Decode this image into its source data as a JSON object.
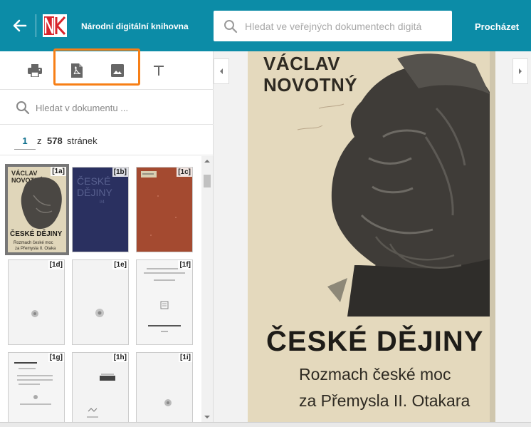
{
  "header": {
    "brand": "Národní digitální knihovna",
    "search_placeholder": "Hledat ve veřejných dokumentech digitá",
    "browse_label": "Procházet",
    "accent_color": "#0c8ca7"
  },
  "toolbar": {
    "icons": [
      "print-icon",
      "pdf-icon",
      "image-icon",
      "text-icon"
    ],
    "highlight_color": "#f77f16"
  },
  "document_search": {
    "placeholder": "Hledat v dokumentu ..."
  },
  "pager": {
    "current": "1",
    "of": "z",
    "total": "578",
    "unit": "stránek"
  },
  "thumbnails": [
    {
      "label": "[1a]",
      "selected": true
    },
    {
      "label": "[1b]"
    },
    {
      "label": "[1c]"
    },
    {
      "label": "[1d]"
    },
    {
      "label": "[1e]"
    },
    {
      "label": "[1f]"
    },
    {
      "label": "[1g]"
    },
    {
      "label": "[1h]"
    },
    {
      "label": "[1i]"
    }
  ],
  "page": {
    "author_line1": "VÁCLAV",
    "author_line2": "NOVOTNÝ",
    "title": "ČESKÉ DĚJINY",
    "subtitle_line1": "Rozmach české moc",
    "subtitle_line2": "za Přemysla II. Otakara"
  }
}
